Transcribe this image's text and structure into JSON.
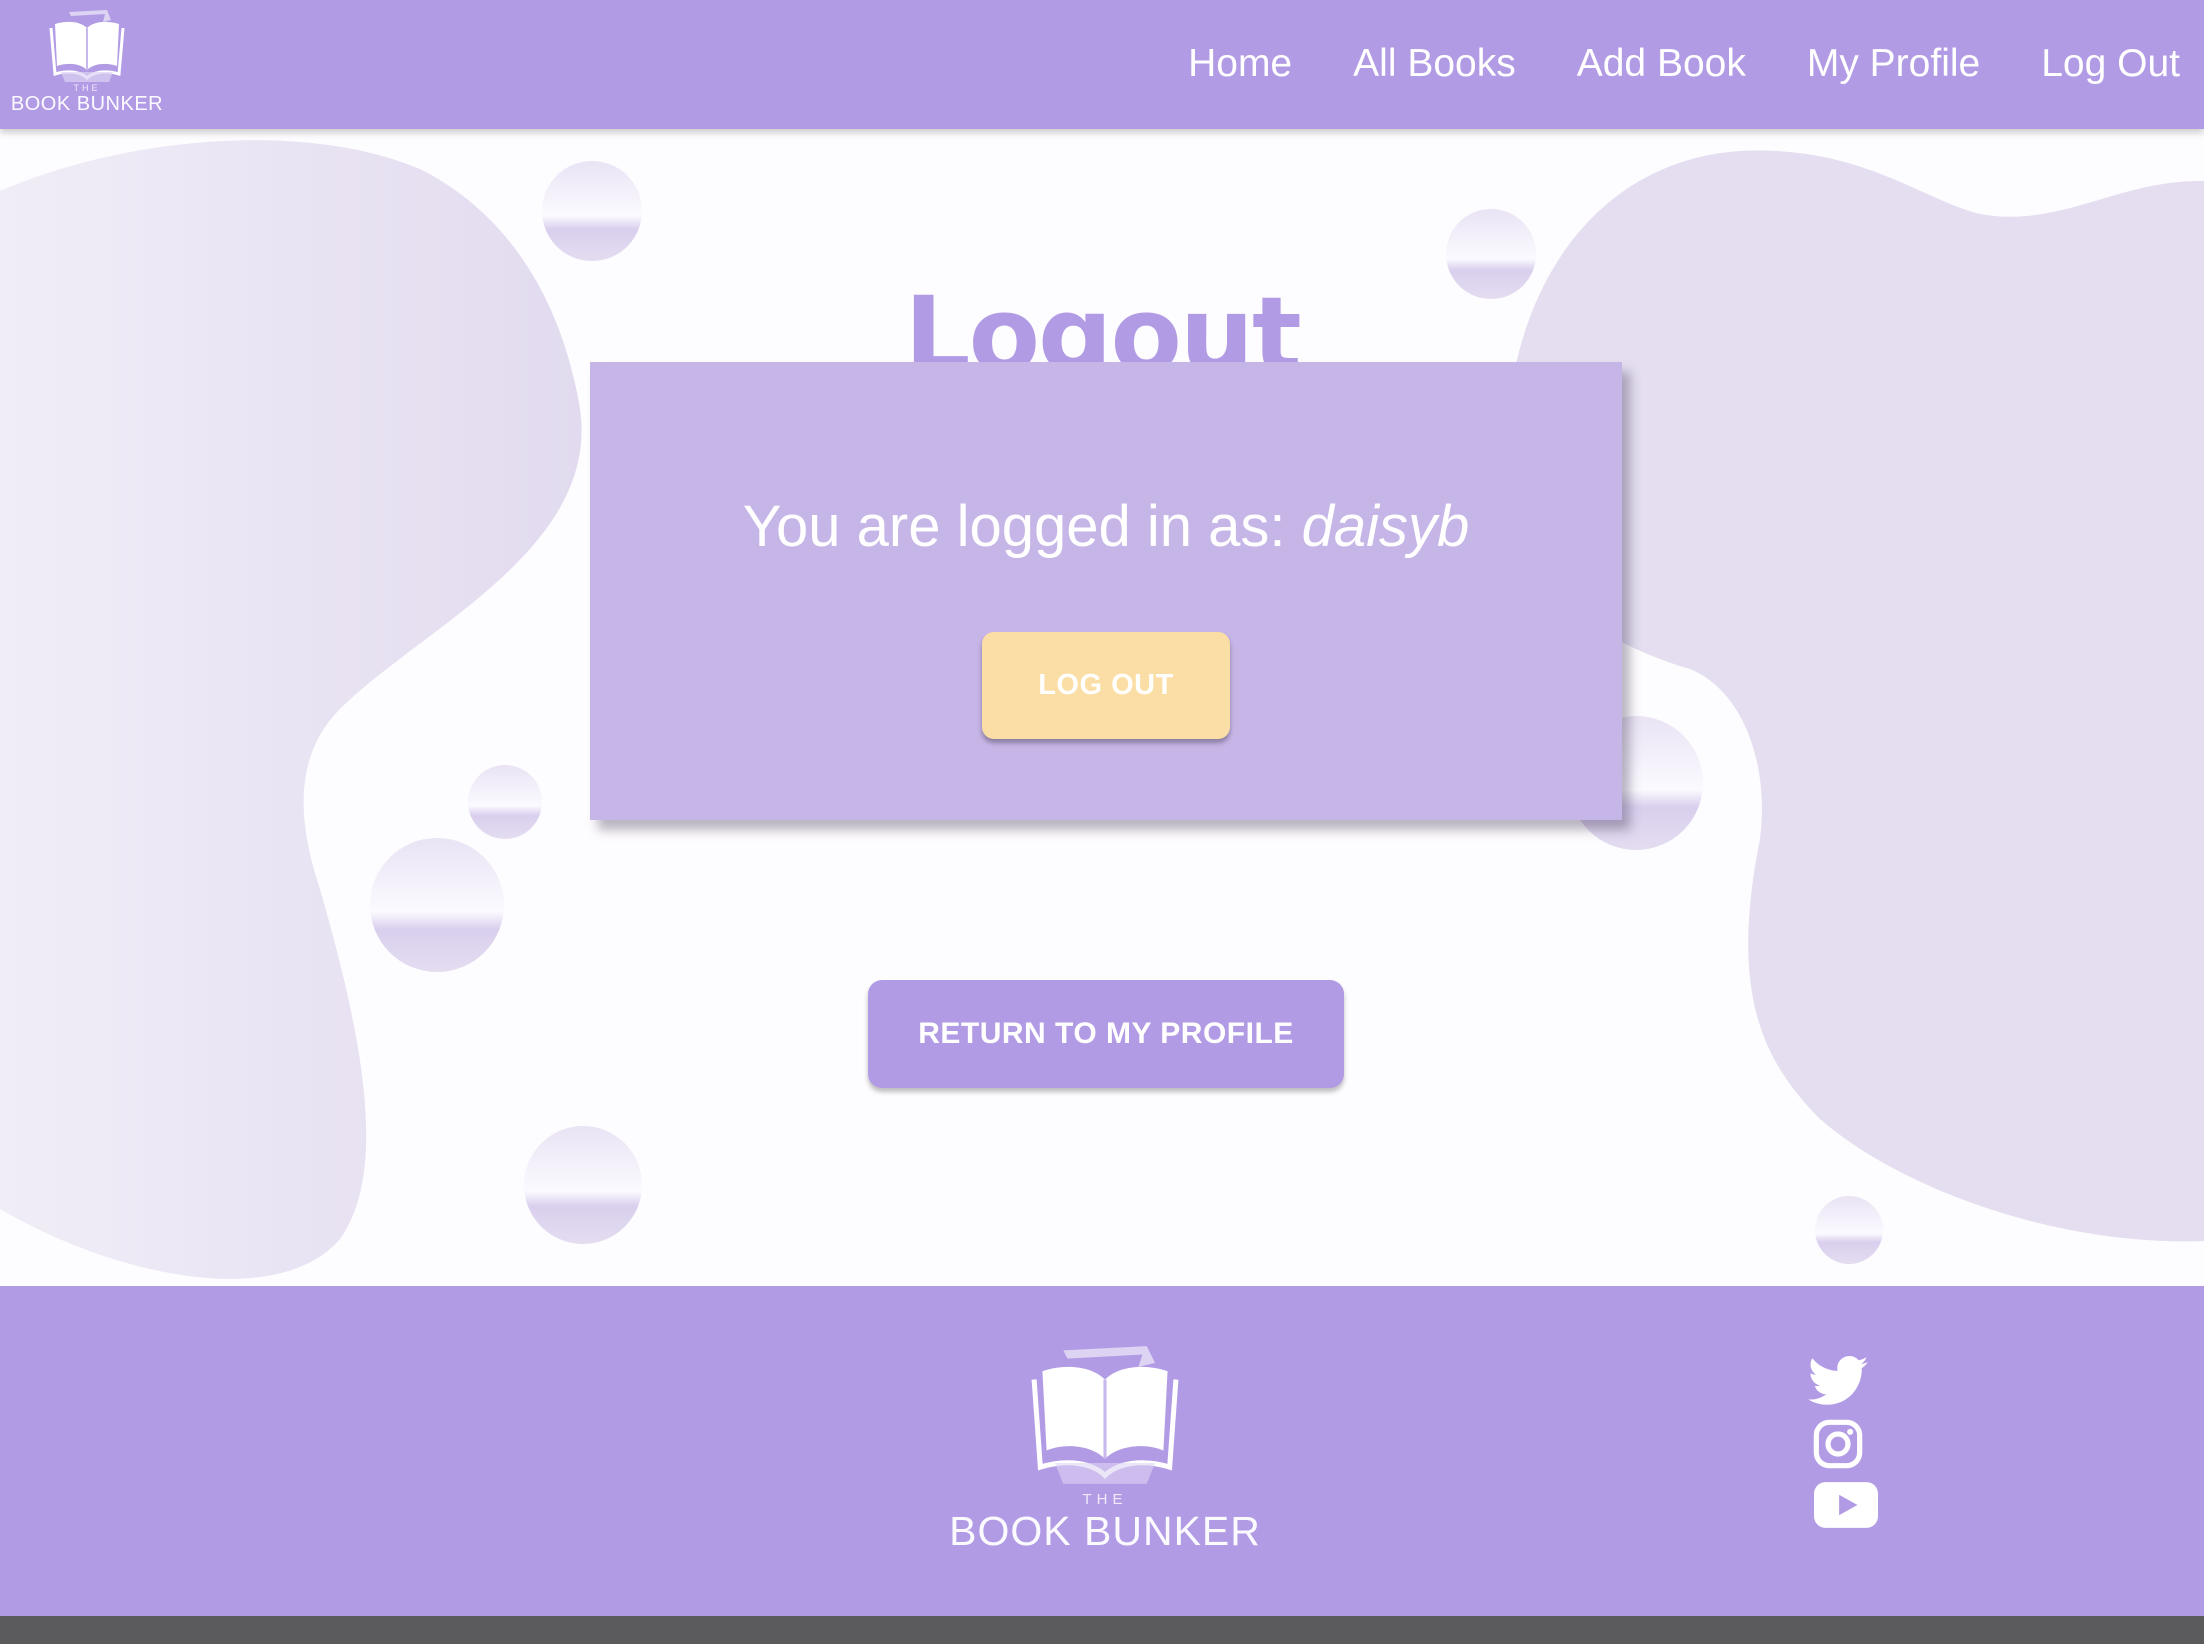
{
  "brand": {
    "the": "THE",
    "name": "BOOK BUNKER"
  },
  "nav": {
    "items": [
      {
        "label": "Home"
      },
      {
        "label": "All Books"
      },
      {
        "label": "Add Book"
      },
      {
        "label": "My Profile"
      },
      {
        "label": "Log Out"
      }
    ]
  },
  "main": {
    "title": "Logout",
    "logged_in_prefix": "You are logged in as: ",
    "username": "daisyb",
    "logout_button": "LOG OUT",
    "return_button": "RETURN TO MY PROFILE"
  },
  "footer": {
    "social": [
      {
        "icon": "twitter-icon"
      },
      {
        "icon": "instagram-icon"
      },
      {
        "icon": "youtube-icon"
      }
    ]
  },
  "colors": {
    "primary": "#b29be5",
    "card": "#c6b5e7",
    "accent_button": "#fbdea5",
    "text_light": "#ffffff",
    "blob": "#e4def0",
    "bottom_strip": "#5b5a5d"
  }
}
